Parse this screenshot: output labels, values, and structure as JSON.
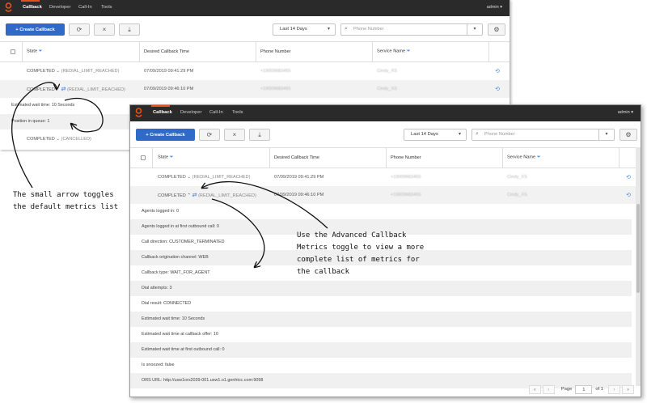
{
  "app": {
    "nav": [
      "Callback",
      "Developer",
      "Call-In",
      "Tools"
    ],
    "user": "admin ▾"
  },
  "toolbar": {
    "create_label": "+ Create Callback",
    "refresh_icon": "refresh-icon",
    "cancel_icon": "close-icon",
    "export_icon": "export-icon",
    "date_range": "Last 14 Days",
    "search_placeholder": "Phone Number",
    "settings_icon": "gear-icon"
  },
  "table": {
    "headers": [
      "State",
      "Desired Callback Time",
      "Phone Number",
      "Service Name"
    ]
  },
  "screen1": {
    "rows": [
      {
        "state": "COMPLETED",
        "reason": "(REDIAL_LIMIT_REACHED)",
        "time": "07/09/2019 09:41:29 PM",
        "phone": "+19009683455",
        "service": "Cindy_XS"
      },
      {
        "state": "COMPLETED",
        "reason": "(REDIAL_LIMIT_REACHED)",
        "time": "07/09/2019 09:46:10 PM",
        "phone": "+19009683455",
        "service": "Cindy_XS"
      }
    ],
    "metrics": [
      "Estimated wait time: 10 Seconds",
      "Position in queue: 1"
    ],
    "last_row": {
      "state": "COMPLETED",
      "reason": "(CANCELLED)"
    }
  },
  "screen2": {
    "rows": [
      {
        "state": "COMPLETED",
        "reason": "(REDIAL_LIMIT_REACHED)",
        "time": "07/09/2019 09:41:29 PM",
        "phone": "+19009683455",
        "service": "Cindy_XS"
      },
      {
        "state": "COMPLETED",
        "reason": "(REDIAL_LIMIT_REACHED)",
        "time": "07/09/2019 09:46:10 PM",
        "phone": "+19009683455",
        "service": "Cindy_XS"
      }
    ],
    "metrics": [
      "Agents logged in: 0",
      "Agents logged in at first outbound call: 0",
      "Call direction: CUSTOMER_TERMINATED",
      "Callback origination channel: WEB",
      "Callback type: WAIT_FOR_AGENT",
      "Dial attempts: 3",
      "Dial result: CONNECTED",
      "Estimated wait time: 10 Seconds",
      "Estimated wait time at callback offer: 10",
      "Estimated wait time at first outbound call: 0",
      "Is snoozed: false",
      "ORS URL: http://usw1ors2039-001.usw1.o1.genhtcc.com:9098"
    ],
    "pager": {
      "label": "Page",
      "page": "1",
      "of": "of 1"
    }
  },
  "annotations": {
    "left": "The small arrow toggles the default metrics list",
    "right": "Use the Advanced Callback Metrics toggle to view a more complete list of metrics for the callback"
  }
}
